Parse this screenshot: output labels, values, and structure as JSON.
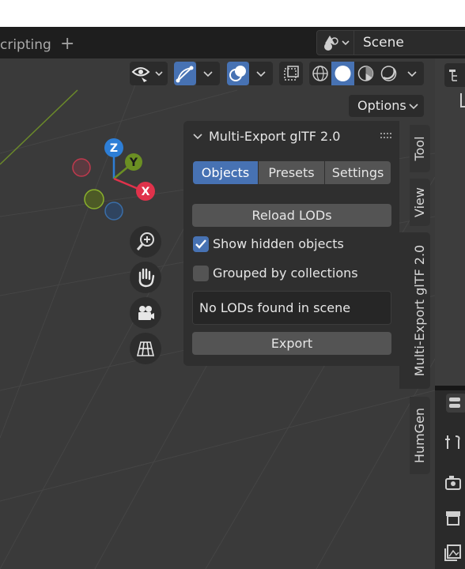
{
  "workspace": {
    "tab_label": "cripting",
    "add_symbol": "+"
  },
  "scene": {
    "name": "Scene"
  },
  "header": {
    "options_label": "Options"
  },
  "gizmo": {
    "z_label": "Z",
    "y_label": "Y",
    "x_label": "X",
    "colors": {
      "x": "#e0324b",
      "y": "#6b8f23",
      "z": "#2d7ed6"
    }
  },
  "panel": {
    "title": "Multi-Export glTF 2.0",
    "tabs": [
      {
        "label": "Objects",
        "active": true
      },
      {
        "label": "Presets",
        "active": false
      },
      {
        "label": "Settings",
        "active": false
      }
    ],
    "reload_label": "Reload LODs",
    "show_hidden": {
      "label": "Show hidden objects",
      "checked": true
    },
    "grouped": {
      "label": "Grouped by collections",
      "checked": false
    },
    "info_text": "No LODs found in scene",
    "export_label": "Export"
  },
  "sidebar_tabs": [
    {
      "label": "Tool",
      "active": false
    },
    {
      "label": "View",
      "active": false
    },
    {
      "label": "Multi-Export glTF 2.0",
      "active": true
    },
    {
      "label": "HumGen",
      "active": false
    }
  ],
  "colors": {
    "accent": "#4772b3",
    "viewport": "#3a3a3a",
    "panel": "#2f2f2f"
  }
}
